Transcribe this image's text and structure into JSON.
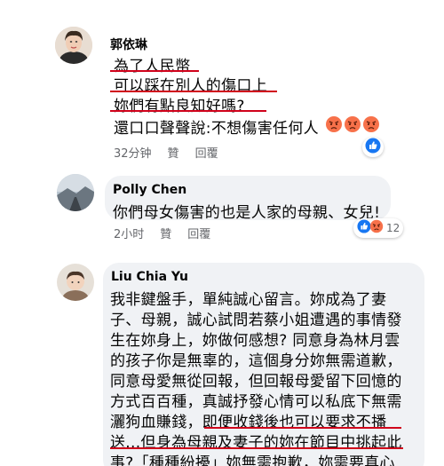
{
  "comments": [
    {
      "author": "郭依琳",
      "lines": [
        "為了人民幣",
        "可以踩在別人的傷口上",
        "妳們有點良知好嗎?",
        "還口口聲聲說:不想傷害任何人"
      ],
      "time": "32分钟",
      "like_label": "贊",
      "reply_label": "回覆"
    },
    {
      "author": "Polly Chen",
      "lines": [
        "你們母女傷害的也是人家的母親、女兒!"
      ],
      "time": "2小时",
      "like_label": "贊",
      "reply_label": "回覆",
      "reaction_count": "12"
    },
    {
      "author": "Liu Chia Yu",
      "lines": [
        "我非鍵盤手，單純誠心留言。妳成為了妻",
        "子、母親，誠心試問若蔡小姐遭遇的事情發",
        "生在妳身上，妳做何感想? 同意身為林月雲",
        "的孩子你是無辜的，這個身分妳無需道歉，",
        "同意母愛無從回報，但回報母愛留下回憶的",
        "方式百百種，真誠抒發心情可以私底下無需",
        "灑狗血賺錢，即便收錢後也可以要求不播",
        "送...但身為母親及妻子的妳在節目中挑起此",
        "事?「種種紛擾」妳無需抱歉，妳需要真心"
      ]
    }
  ],
  "colors": {
    "underline": "#d0021b",
    "like_blue": "#1877f2",
    "angry_orange": "#f7714a"
  },
  "icons": {
    "angry": "angry-emoji-icon",
    "like": "like-thumb-icon"
  }
}
